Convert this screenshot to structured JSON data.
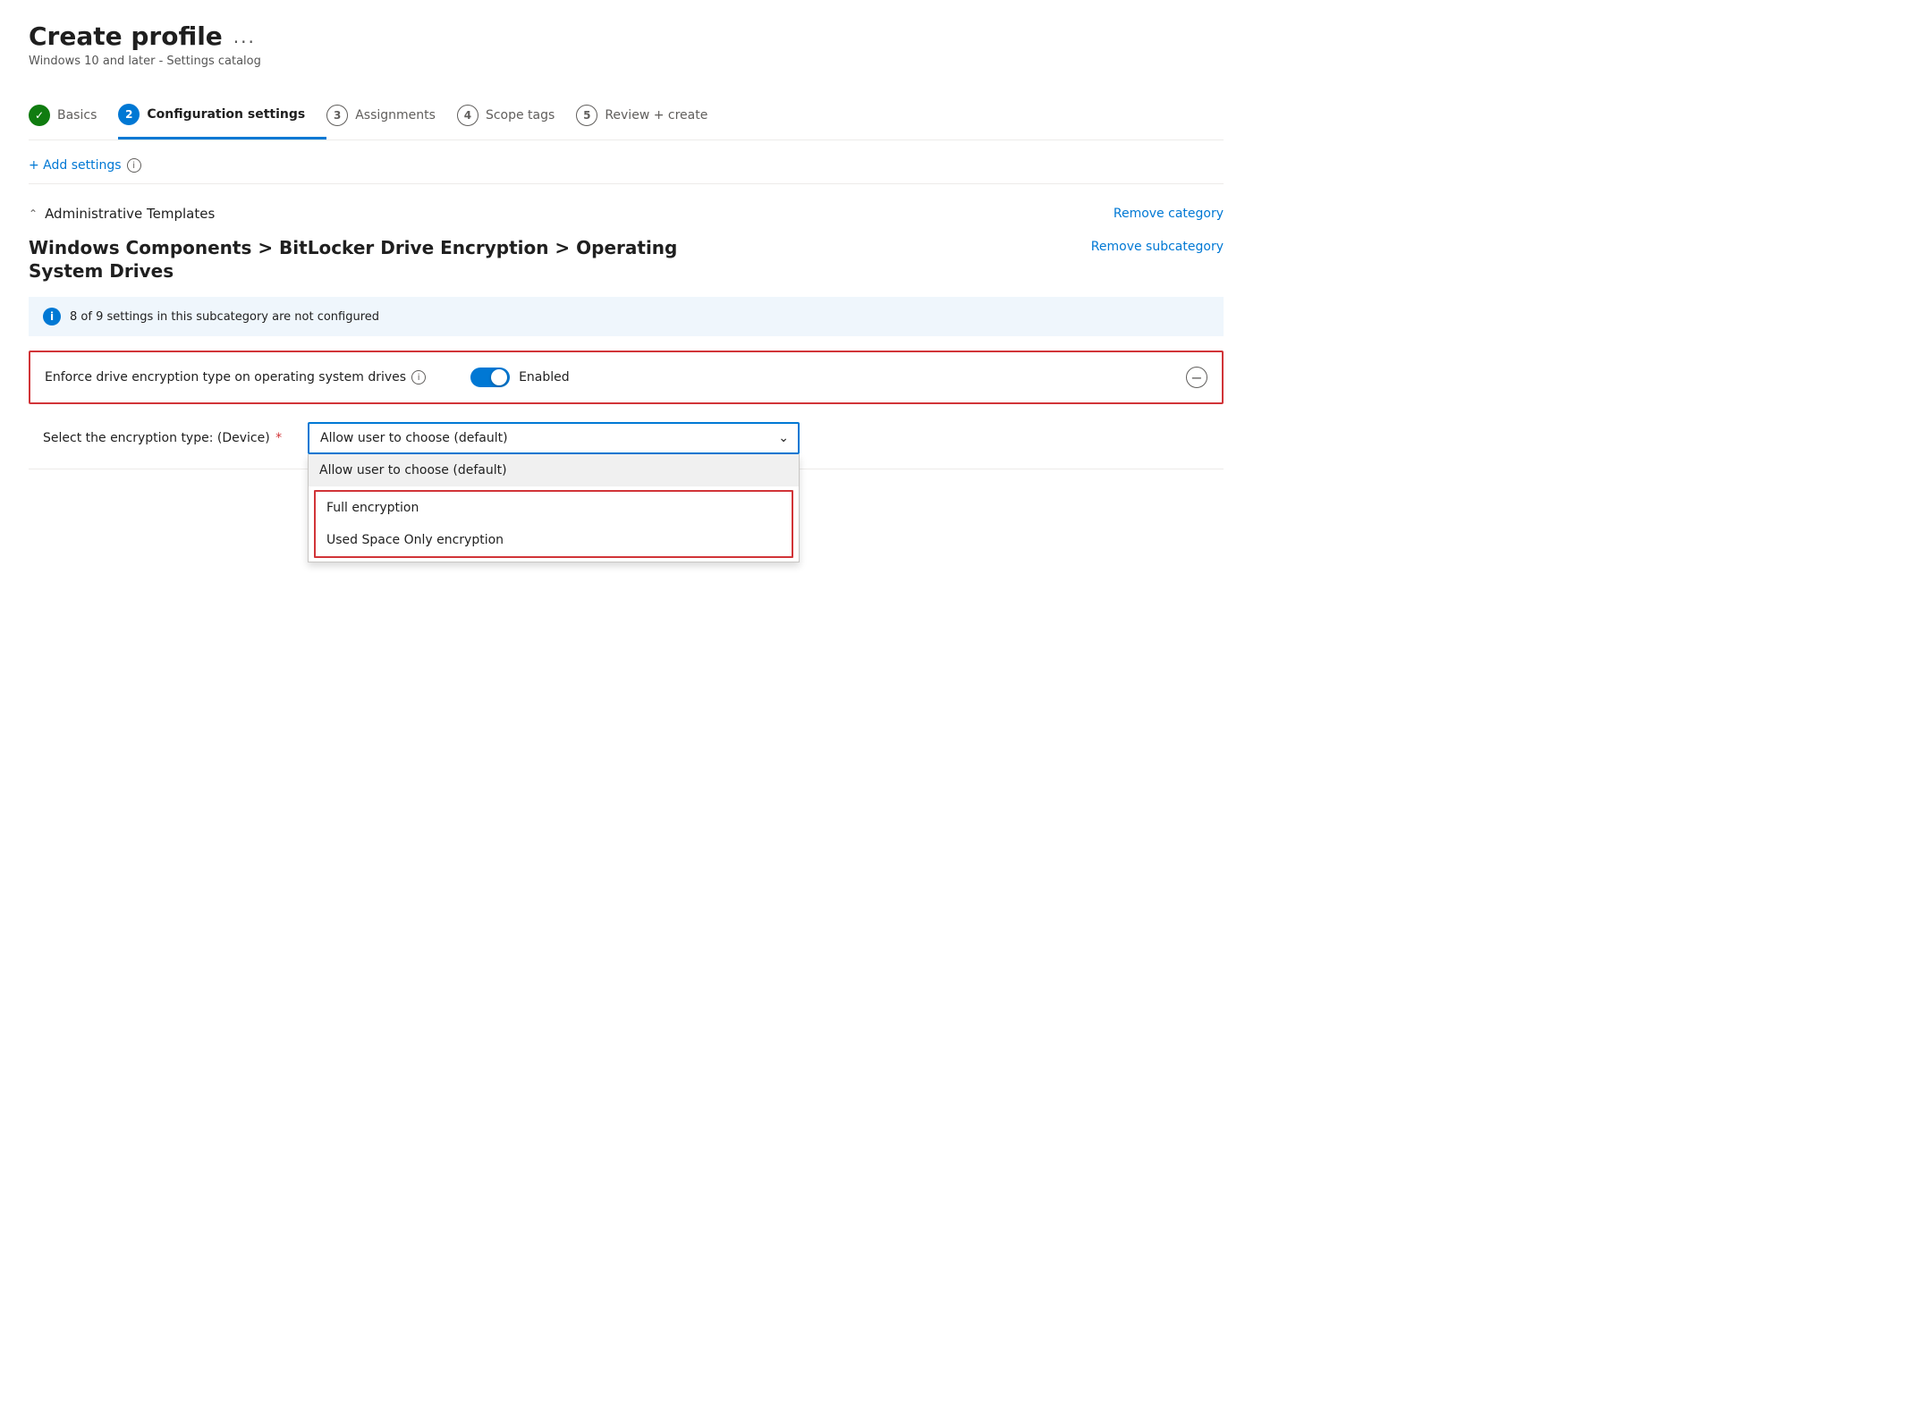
{
  "page": {
    "title": "Create profile",
    "title_ellipsis": "...",
    "subtitle": "Windows 10 and later - Settings catalog"
  },
  "wizard": {
    "steps": [
      {
        "id": "basics",
        "number": "✓",
        "label": "Basics",
        "state": "completed"
      },
      {
        "id": "configuration",
        "number": "2",
        "label": "Configuration settings",
        "state": "active"
      },
      {
        "id": "assignments",
        "number": "3",
        "label": "Assignments",
        "state": "inactive"
      },
      {
        "id": "scope",
        "number": "4",
        "label": "Scope tags",
        "state": "inactive"
      },
      {
        "id": "review",
        "number": "5",
        "label": "Review + create",
        "state": "inactive"
      }
    ]
  },
  "add_settings": {
    "label": "+ Add settings"
  },
  "category": {
    "name": "Administrative Templates",
    "remove_label": "Remove category"
  },
  "subcategory": {
    "title": "Windows Components > BitLocker Drive Encryption > Operating System Drives",
    "remove_label": "Remove subcategory"
  },
  "info_banner": {
    "text": "8 of 9 settings in this subcategory are not configured"
  },
  "setting": {
    "label": "Enforce drive encryption type on operating system drives",
    "toggle_state": "Enabled",
    "minus_label": "−"
  },
  "encryption_field": {
    "label": "Select the encryption type: (Device)",
    "required": true,
    "selected_value": "Allow user to choose (default)",
    "options": [
      {
        "id": "allow",
        "label": "Allow user to choose (default)",
        "state": "selected"
      },
      {
        "id": "full",
        "label": "Full encryption",
        "state": "highlighted"
      },
      {
        "id": "used",
        "label": "Used Space Only encryption",
        "state": "highlighted"
      }
    ]
  }
}
